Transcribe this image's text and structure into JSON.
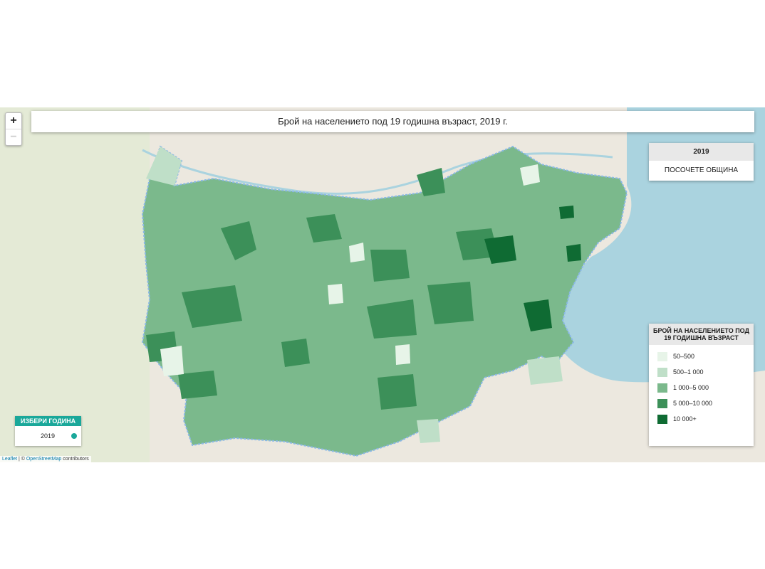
{
  "map": {
    "title": "Брой на населението под 19 годишна възраст, 2019 г.",
    "zoom_in": "+",
    "zoom_out": "−",
    "info": {
      "year": "2019",
      "hint": "ПОСОЧЕТЕ ОБЩИНА"
    },
    "legend": {
      "title": "БРОЙ НА НАСЕЛЕНИЕТО ПОД 19 ГОДИШНА ВЪЗРАСТ",
      "items": [
        {
          "label": "50–500",
          "color": "#e7f4e8"
        },
        {
          "label": "500–1 000",
          "color": "#bfdfc8"
        },
        {
          "label": "1 000–5 000",
          "color": "#7bb98c"
        },
        {
          "label": "5 000–10 000",
          "color": "#3c9059"
        },
        {
          "label": "10 000+",
          "color": "#0f6b33"
        }
      ]
    },
    "year_selector": {
      "label": "ИЗБЕРИ ГОДИНА",
      "value": "2019"
    },
    "attribution": {
      "leaflet": "Leaflet",
      "sep": " | © ",
      "osm": "OpenStreetMap",
      "tail": " contributors"
    },
    "colors": {
      "sea": "#aad3df",
      "land": "#e9e6de",
      "accent": "#1aa89a"
    }
  }
}
